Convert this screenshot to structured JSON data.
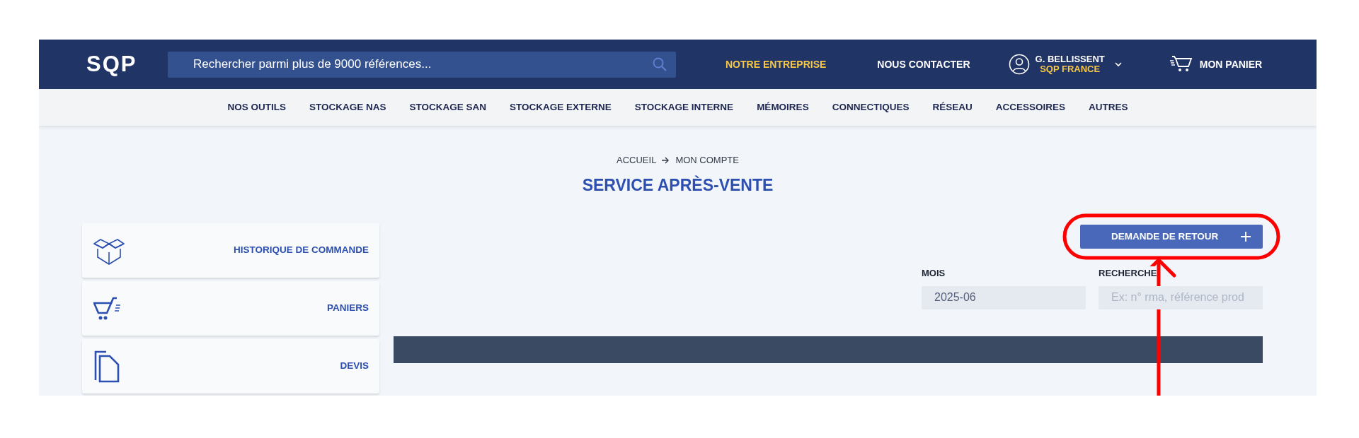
{
  "header": {
    "logo": "SQP",
    "search": {
      "placeholder": "Rechercher parmi plus de 9000 références..."
    },
    "links": [
      {
        "label": "NOTRE ENTREPRISE",
        "selected": true
      },
      {
        "label": "NOUS CONTACTER",
        "selected": false
      }
    ],
    "account": {
      "name": "G. BELLISSENT",
      "company": "SQP FRANCE"
    },
    "cart": {
      "label": "MON PANIER"
    }
  },
  "categories": [
    "NOS OUTILS",
    "STOCKAGE NAS",
    "STOCKAGE SAN",
    "STOCKAGE EXTERNE",
    "STOCKAGE INTERNE",
    "MÉMOIRES",
    "CONNECTIQUES",
    "RÉSEAU",
    "ACCESSOIRES",
    "AUTRES"
  ],
  "breadcrumb": [
    "ACCUEIL",
    "MON COMPTE"
  ],
  "page_title": "SERVICE APRÈS-VENTE",
  "sidebar": {
    "items": [
      {
        "kind": "box",
        "label": "HISTORIQUE DE COMMANDE"
      },
      {
        "kind": "cart",
        "label": "PANIERS"
      },
      {
        "kind": "documents",
        "label": "DEVIS"
      }
    ]
  },
  "return_button": {
    "label": "DEMANDE DE RETOUR"
  },
  "filters": [
    {
      "label": "MOIS",
      "value": "2025-06"
    },
    {
      "label": "RECHERCHE",
      "placeholder": "Ex: n° rma, référence prod"
    }
  ],
  "annotations": {
    "highlight_ellipse": true,
    "arrow": true
  }
}
